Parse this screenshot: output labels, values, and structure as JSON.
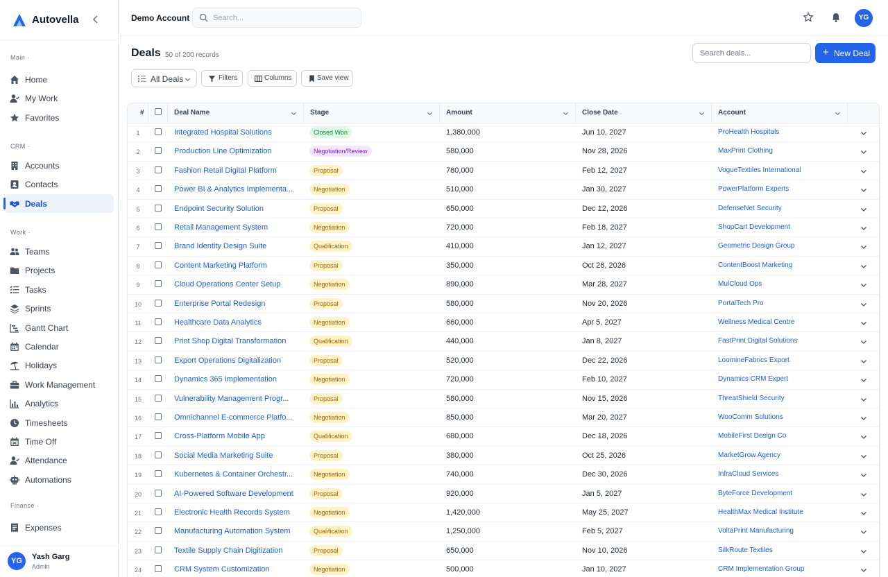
{
  "app": {
    "name": "Autovella"
  },
  "sidebar": {
    "sections": [
      {
        "label": "Main ·",
        "items": [
          {
            "label": "Home",
            "icon": "home-icon"
          },
          {
            "label": "My Work",
            "icon": "user-check-icon"
          },
          {
            "label": "Favorites",
            "icon": "star-icon"
          }
        ]
      },
      {
        "label": "CRM ·",
        "items": [
          {
            "label": "Accounts",
            "icon": "building-icon"
          },
          {
            "label": "Contacts",
            "icon": "contact-card-icon"
          },
          {
            "label": "Deals",
            "icon": "handshake-icon",
            "active": true
          }
        ]
      },
      {
        "label": "Work ·",
        "items": [
          {
            "label": "Teams",
            "icon": "users-icon"
          },
          {
            "label": "Projects",
            "icon": "folder-icon"
          },
          {
            "label": "Tasks",
            "icon": "list-check-icon"
          },
          {
            "label": "Sprints",
            "icon": "layers-icon"
          },
          {
            "label": "Gantt Chart",
            "icon": "gantt-icon"
          },
          {
            "label": "Calendar",
            "icon": "calendar-icon"
          },
          {
            "label": "Holidays",
            "icon": "umbrella-beach-icon"
          },
          {
            "label": "Work Management",
            "icon": "briefcase-icon"
          },
          {
            "label": "Analytics",
            "icon": "bar-chart-icon"
          },
          {
            "label": "Timesheets",
            "icon": "clock-icon"
          },
          {
            "label": "Time Off",
            "icon": "calendar-off-icon"
          },
          {
            "label": "Attendance",
            "icon": "user-check-icon"
          },
          {
            "label": "Automations",
            "icon": "robot-icon"
          }
        ]
      },
      {
        "label": "Finance ·",
        "items": [
          {
            "label": "Expenses",
            "icon": "receipt-icon"
          }
        ]
      }
    ],
    "user": {
      "initials": "YG",
      "name": "Yash Garg",
      "role": "Admin"
    }
  },
  "topbar": {
    "account": "Demo Account",
    "search_placeholder": "Search...",
    "avatar_initials": "YG"
  },
  "page": {
    "title": "Deals",
    "record_count": "50 of 200 records",
    "search_placeholder": "Search deals...",
    "new_button": "New Deal",
    "toolbar": {
      "view": "All Deals",
      "filters": "Filters",
      "columns": "Columns",
      "save_view": "Save view"
    }
  },
  "table": {
    "columns": {
      "num": "#",
      "name": "Deal Name",
      "stage": "Stage",
      "amount": "Amount",
      "close_date": "Close Date",
      "account": "Account"
    },
    "stage_colors": {
      "Closed Won": {
        "bg": "#dcfce7",
        "fg": "#15803d"
      },
      "Negotiation/Review": {
        "bg": "#f3e8ff",
        "fg": "#7e22ce"
      },
      "Proposal": {
        "bg": "#fef3c7",
        "fg": "#a16207"
      },
      "Negotiation": {
        "bg": "#fef3c7",
        "fg": "#a16207"
      },
      "Qualification": {
        "bg": "#fef3c7",
        "fg": "#a16207"
      }
    },
    "rows": [
      {
        "num": "1",
        "name": "Integrated Hospital Solutions",
        "stage": "Closed Won",
        "amount": "1,380,000",
        "close_date": "Jun 10, 2027",
        "account": "ProHealth Hospitals"
      },
      {
        "num": "2",
        "name": "Production Line Optimization",
        "stage": "Negotiation/Review",
        "amount": "580,000",
        "close_date": "Nov 28, 2026",
        "account": "MaxPrint Clothing"
      },
      {
        "num": "3",
        "name": "Fashion Retail Digital Platform",
        "stage": "Proposal",
        "amount": "780,000",
        "close_date": "Feb 12, 2027",
        "account": "VogueTextiles International"
      },
      {
        "num": "4",
        "name": "Power BI & Analytics Implementa...",
        "stage": "Negotiation",
        "amount": "510,000",
        "close_date": "Jan 30, 2027",
        "account": "PowerPlatform Experts"
      },
      {
        "num": "5",
        "name": "Endpoint Security Solution",
        "stage": "Proposal",
        "amount": "650,000",
        "close_date": "Dec 12, 2026",
        "account": "DefenseNet Security"
      },
      {
        "num": "6",
        "name": "Retail Management System",
        "stage": "Negotiation",
        "amount": "720,000",
        "close_date": "Feb 18, 2027",
        "account": "ShopCart Development"
      },
      {
        "num": "7",
        "name": "Brand Identity Design Suite",
        "stage": "Qualification",
        "amount": "410,000",
        "close_date": "Jan 12, 2027",
        "account": "Geometric Design Group"
      },
      {
        "num": "8",
        "name": "Content Marketing Platform",
        "stage": "Proposal",
        "amount": "350,000",
        "close_date": "Oct 28, 2026",
        "account": "ContentBoost Marketing"
      },
      {
        "num": "9",
        "name": "Cloud Operations Center Setup",
        "stage": "Negotiation",
        "amount": "890,000",
        "close_date": "Mar 28, 2027",
        "account": "MulCloud Ops"
      },
      {
        "num": "10",
        "name": "Enterprise Portal Redesign",
        "stage": "Proposal",
        "amount": "580,000",
        "close_date": "Nov 20, 2026",
        "account": "PortalTech Pro"
      },
      {
        "num": "11",
        "name": "Healthcare Data Analytics",
        "stage": "Negotiation",
        "amount": "660,000",
        "close_date": "Apr 5, 2027",
        "account": "Wellness Medical Centre"
      },
      {
        "num": "12",
        "name": "Print Shop Digital Transformation",
        "stage": "Qualification",
        "amount": "440,000",
        "close_date": "Jan 8, 2027",
        "account": "FastPrint Digital Solutions"
      },
      {
        "num": "13",
        "name": "Export Operations Digitalization",
        "stage": "Proposal",
        "amount": "520,000",
        "close_date": "Dec 22, 2026",
        "account": "LoomineFabrics Export"
      },
      {
        "num": "14",
        "name": "Dynamics 365 Implementation",
        "stage": "Negotiation",
        "amount": "720,000",
        "close_date": "Feb 10, 2027",
        "account": "Dynamics CRM Expert"
      },
      {
        "num": "15",
        "name": "Vulnerability Management Progr...",
        "stage": "Proposal",
        "amount": "580,000",
        "close_date": "Nov 15, 2026",
        "account": "ThreatShield Security"
      },
      {
        "num": "16",
        "name": "Omnichannel E-commerce Platfo...",
        "stage": "Negotiation",
        "amount": "850,000",
        "close_date": "Mar 20, 2027",
        "account": "WooComm Solutions"
      },
      {
        "num": "17",
        "name": "Cross-Platform Mobile App",
        "stage": "Qualification",
        "amount": "680,000",
        "close_date": "Dec 18, 2026",
        "account": "MobileFirst Design Co"
      },
      {
        "num": "18",
        "name": "Social Media Marketing Suite",
        "stage": "Proposal",
        "amount": "380,000",
        "close_date": "Oct 25, 2026",
        "account": "MarketGrow Agency"
      },
      {
        "num": "19",
        "name": "Kubernetes & Container Orchestr...",
        "stage": "Negotiation",
        "amount": "740,000",
        "close_date": "Dec 30, 2026",
        "account": "InfraCloud Services"
      },
      {
        "num": "20",
        "name": "AI-Powered Software Development",
        "stage": "Proposal",
        "amount": "920,000",
        "close_date": "Jan 5, 2027",
        "account": "ByteForce Development"
      },
      {
        "num": "21",
        "name": "Electronic Health Records System",
        "stage": "Negotiation",
        "amount": "1,420,000",
        "close_date": "May 25, 2027",
        "account": "HealthMax Medical Institute"
      },
      {
        "num": "22",
        "name": "Manufacturing Automation System",
        "stage": "Qualification",
        "amount": "1,250,000",
        "close_date": "Feb 5, 2027",
        "account": "VoltaPrint Manufacturing"
      },
      {
        "num": "23",
        "name": "Textile Supply Chain Digitization",
        "stage": "Proposal",
        "amount": "650,000",
        "close_date": "Nov 10, 2026",
        "account": "SilkRoute Textiles"
      },
      {
        "num": "24",
        "name": "CRM System Customization",
        "stage": "Negotiation",
        "amount": "500,000",
        "close_date": "Jan 10, 2027",
        "account": "CRM Implementation Group"
      }
    ]
  }
}
